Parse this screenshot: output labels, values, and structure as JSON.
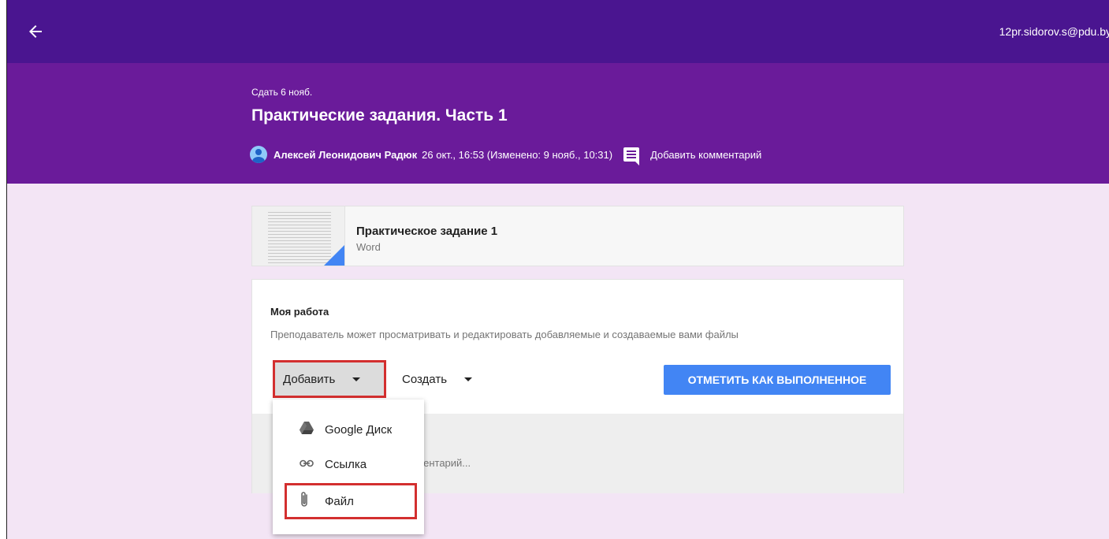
{
  "topbar": {
    "back_icon": "arrow-left-icon",
    "user_email": "12pr.sidorov.s@pdu.by"
  },
  "assignment": {
    "due": "Сдать 6 нояб.",
    "title": "Практические задания. Часть 1",
    "author": "Алексей Леонидович Радюк",
    "date": "26 окт., 16:53 (Изменено: 9 нояб., 10:31)",
    "add_comment": "Добавить комментарий"
  },
  "attachment": {
    "title": "Практическое задание 1",
    "type": "Word"
  },
  "my_work": {
    "title": "Моя работа",
    "description": "Преподаватель может просматривать и редактировать добавляемые и создаваемые вами файлы",
    "add_label": "Добавить",
    "create_label": "Создать",
    "mark_done_label": "ОТМЕТИТЬ КАК ВЫПОЛНЕННОЕ",
    "comment_placeholder": "омментарий..."
  },
  "add_menu": {
    "items": [
      {
        "label": "Google Диск",
        "icon": "google-drive-icon"
      },
      {
        "label": "Ссылка",
        "icon": "link-icon"
      },
      {
        "label": "Файл",
        "icon": "paperclip-icon"
      }
    ]
  },
  "colors": {
    "topbar": "#4a1590",
    "header": "#6a1b9a",
    "page_bg": "#f3e5f5",
    "primary_button": "#4285f4",
    "highlight": "#d32f2f"
  }
}
